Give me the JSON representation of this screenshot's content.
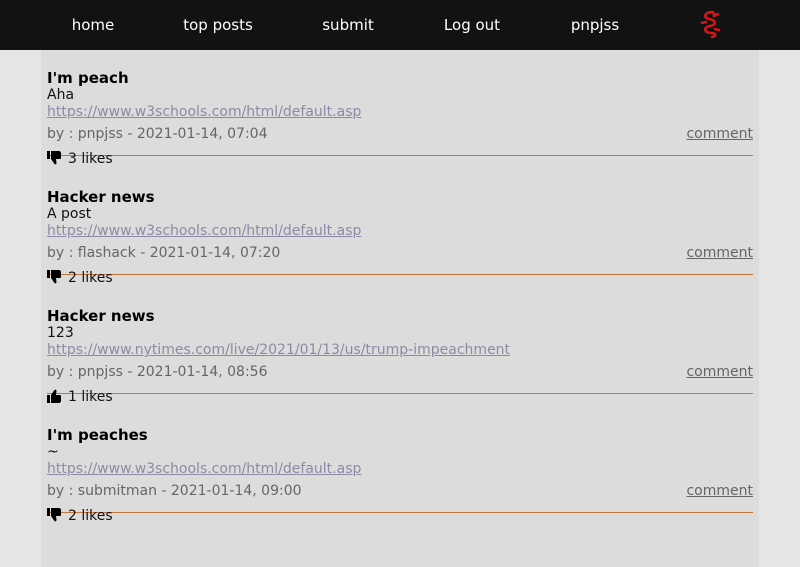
{
  "nav": {
    "home": "home",
    "top_posts": "top posts",
    "submit": "submit",
    "logout": "Log out",
    "user": "pnpjss",
    "logo_icon": "red-dragon-logo-icon"
  },
  "colors": {
    "nav_bg": "#121212",
    "content_bg": "#dcdcdc",
    "page_bg": "#e5e5e5",
    "divider": "#c7753f",
    "link": "#8b8ba5",
    "logo": "#d01818"
  },
  "posts": [
    {
      "title": "I'm peach",
      "body": "Aha",
      "url": "https://www.w3schools.com/html/default.asp",
      "meta": "by : pnpjss - 2021-01-14, 07:04",
      "comment": "comment",
      "likes": "3 likes",
      "like_icon": "thumbs-down-icon"
    },
    {
      "title": "Hacker news",
      "body": "A post",
      "url": "https://www.w3schools.com/html/default.asp",
      "meta": "by : flashack - 2021-01-14, 07:20",
      "comment": "comment",
      "likes": "2 likes",
      "like_icon": "thumbs-down-icon"
    },
    {
      "title": "Hacker news",
      "body": "123",
      "url": "https://www.nytimes.com/live/2021/01/13/us/trump-impeachment",
      "meta": "by : pnpjss - 2021-01-14, 08:56",
      "comment": "comment",
      "likes": "1 likes",
      "like_icon": "thumbs-up-icon"
    },
    {
      "title": "I'm peaches",
      "body": "~",
      "url": "https://www.w3schools.com/html/default.asp",
      "meta": "by : submitman - 2021-01-14, 09:00",
      "comment": "comment",
      "likes": "2 likes",
      "like_icon": "thumbs-down-icon"
    }
  ]
}
